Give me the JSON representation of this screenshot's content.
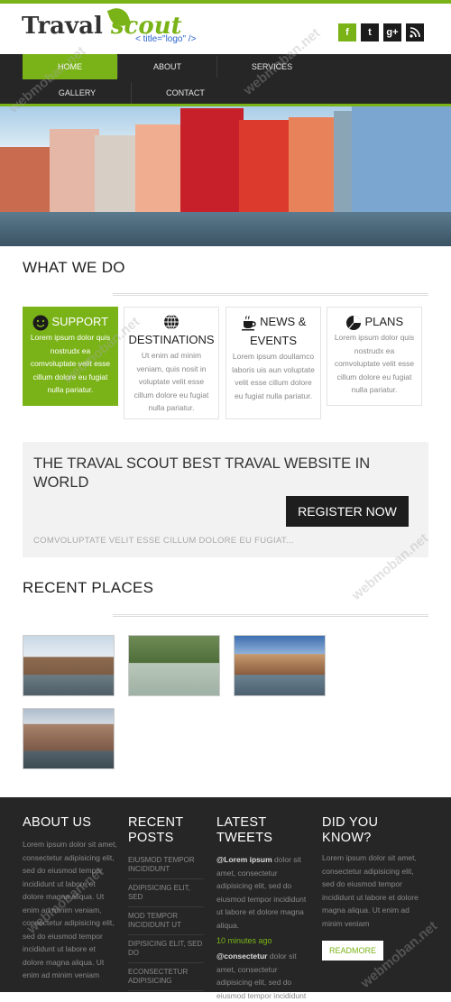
{
  "header": {
    "logo_main": "Traval",
    "logo_accent": "scout",
    "logo_tag": "< title=\"logo\" />",
    "social": [
      "f",
      "t",
      "g+",
      "rss"
    ]
  },
  "nav": {
    "items": [
      "HOME",
      "ABOUT",
      "SERVICES",
      "GALLERY",
      "CONTACT"
    ],
    "active": "HOME"
  },
  "what_we_do": {
    "title": "WHAT WE DO",
    "cards": [
      {
        "title": "SUPPORT",
        "body": "Lorem ipsum dolor quis nostrudx ea comvoluptate velit esse cillum dolore eu fugiat nulla pariatur.",
        "icon": "smiley-icon"
      },
      {
        "title": "DESTINATIONS",
        "body": "Ut enim ad minim veniam, quis nosit in voluptate velit esse cillum dolore eu fugiat nulla pariatur.",
        "icon": "globe-icon"
      },
      {
        "title": "NEWS & EVENTS",
        "body": "Lorem ipsum doullamco laboris uis aun voluptate velit esse cillum dolore eu fugiat nulla pariatur.",
        "icon": "coffee-icon"
      },
      {
        "title": "PLANS",
        "body": "Lorem ipsum dolor quis nostrudx ea comvoluptate velit esse cillum dolore eu fugiat nulla pariatur.",
        "icon": "pie-chart-icon"
      }
    ]
  },
  "promo": {
    "headline": "THE TRAVAL SCOUT BEST TRAVAL WEBSITE IN WORLD",
    "button": "REGISTER NOW",
    "sub": "COMVOLUPTATE VELIT ESSE CILLUM DOLORE EU FUGIAT..."
  },
  "recent_places": {
    "title": "RECENT PLACES"
  },
  "footer": {
    "about": {
      "title": "ABOUT US",
      "text": "Lorem ipsum dolor sit amet, consectetur adipisicing elit, sed do eiusmod tempor incididunt ut labore et dolore magna aliqua. Ut enim ad minim veniam, consectetur adipisicing elit, sed do eiusmod tempor incididunt ut labore et dolore magna aliqua. Ut enim ad minim veniam"
    },
    "recent_posts": {
      "title": "RECENT POSTS",
      "items": [
        "EIUSMOD TEMPOR INCIDIDUNT",
        "ADIPISICING ELIT, SED",
        "MOD TEMPOR INCIDIDUNT UT",
        "DIPISICING ELIT, SED DO",
        "ECONSECTETUR ADIPISICING"
      ]
    },
    "tweets": {
      "title": "LATEST TWEETS",
      "tweet1_user": "@Lorem ipsum",
      "tweet1_text": "dolor sit amet, consectetur adipisicing elit, sed do eiusmod tempor incididunt ut labore et dolore magna aliqua.",
      "time": "10 minutes ago",
      "tweet2_user": "@consectetur",
      "tweet2_text": "dolor sit amet, consectetur adipisicing elit, sed do eiusmod tempor incididunt"
    },
    "know": {
      "title": "DID YOU KNOW?",
      "text": "Lorem ipsum dolor sit amet, consectetur adipisicing elit, sed do eiusmod tempor incididunt ut labore et dolore magna aliqua. Ut enim ad minim veniam",
      "button": "READMORE"
    }
  },
  "watermark": "webmoban.net",
  "colors": {
    "accent": "#7ab317",
    "dark": "#262626"
  }
}
